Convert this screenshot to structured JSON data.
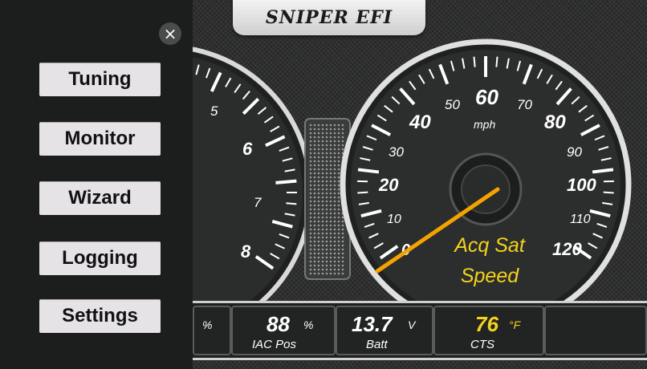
{
  "brand": {
    "logo_text": "SNIPER EFI"
  },
  "menu": {
    "close_glyph": "×",
    "items": [
      {
        "label": "Tuning"
      },
      {
        "label": "Monitor"
      },
      {
        "label": "Wizard"
      },
      {
        "label": "Logging"
      },
      {
        "label": "Settings"
      }
    ]
  },
  "tach": {
    "labels": [
      "5",
      "6",
      "7",
      "8"
    ]
  },
  "speedo": {
    "unit": "mph",
    "labels": [
      "0",
      "10",
      "20",
      "30",
      "40",
      "50",
      "60",
      "70",
      "80",
      "90",
      "100",
      "110",
      "120"
    ],
    "status_line1": "Acq Sat",
    "status_line2": "Speed",
    "needle_value": 0,
    "needle_color": "#f5a300"
  },
  "databar": {
    "partial_unit": "%",
    "cells": [
      {
        "value": "88",
        "unit": "%",
        "label": "IAC Pos"
      },
      {
        "value": "13.7",
        "unit": "V",
        "label": "Batt"
      },
      {
        "value": "76",
        "unit": "°F",
        "label": "CTS"
      }
    ]
  },
  "colors": {
    "accent_yellow": "#f5d21e",
    "needle": "#f5a300"
  }
}
